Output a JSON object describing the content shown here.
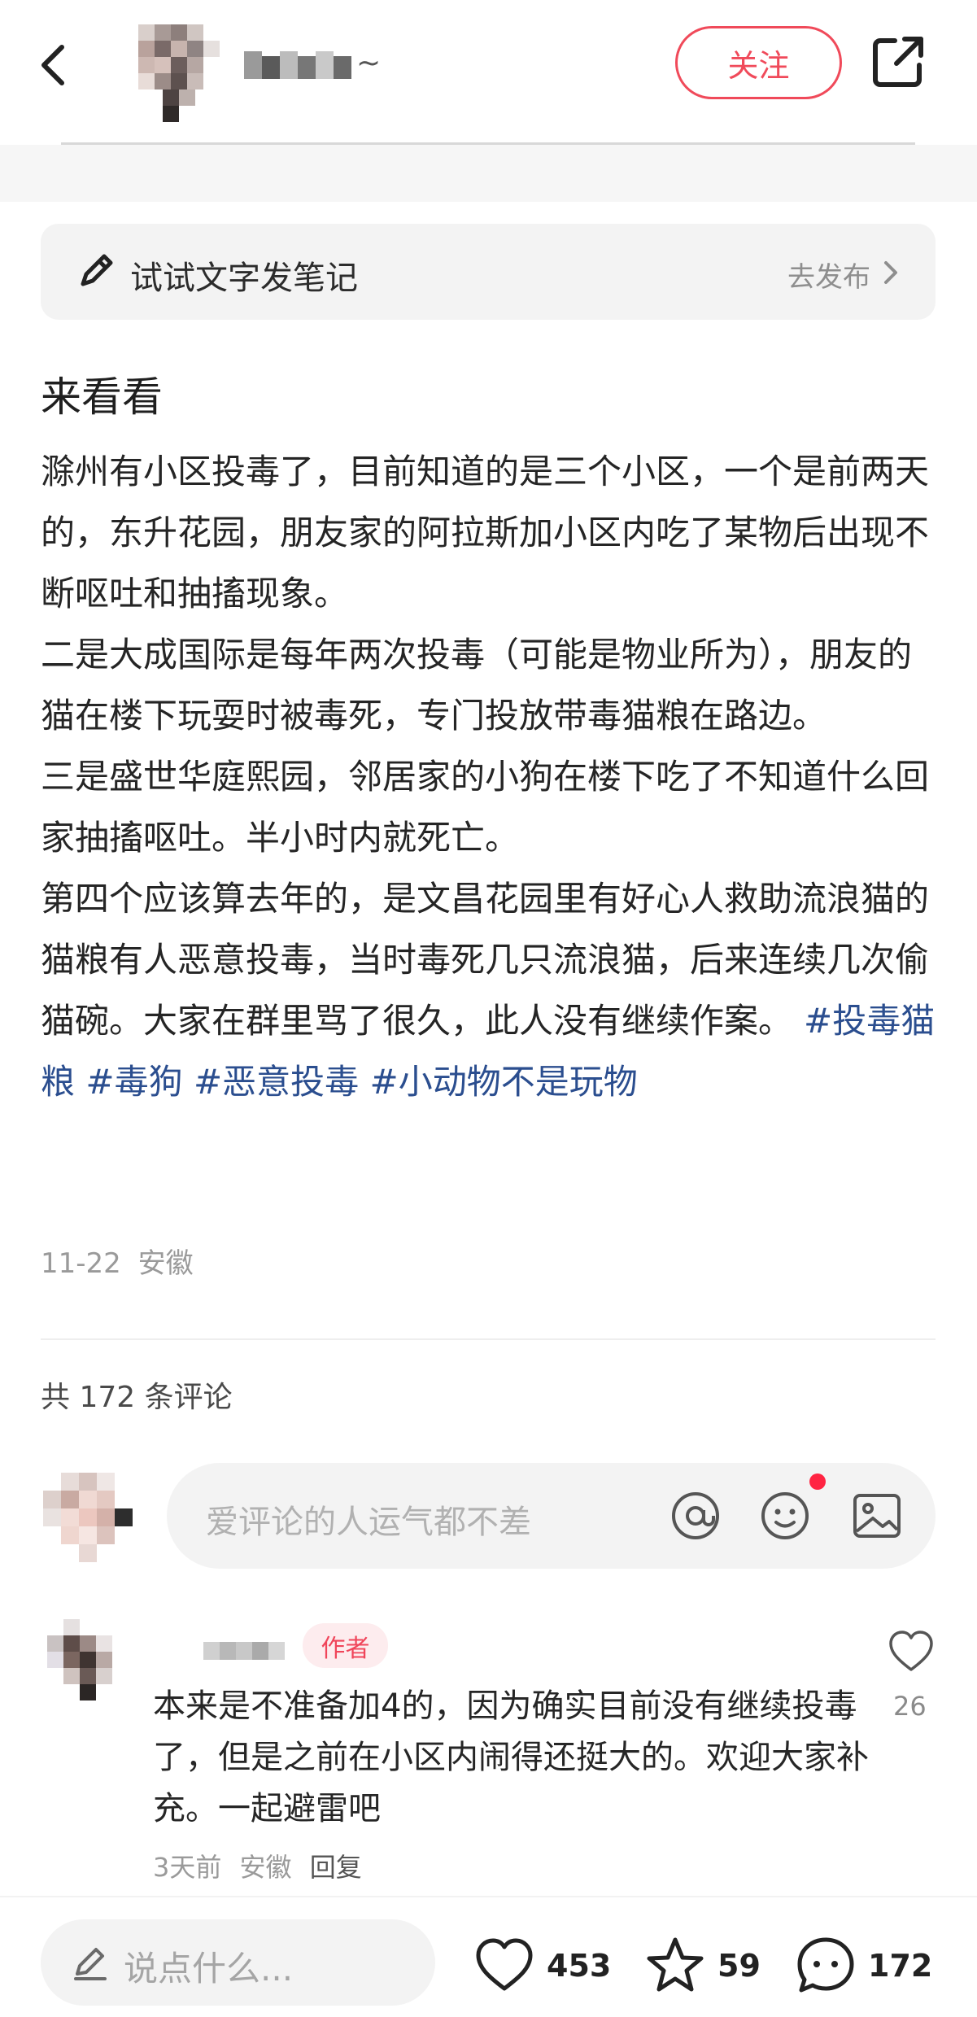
{
  "header": {
    "back_icon": "chevron-left-icon",
    "username_suffix": "~",
    "follow_label": "关注",
    "share_icon": "share-external-icon",
    "accent_color": "#f04a5a"
  },
  "note_entry": {
    "label": "试试文字发笔记",
    "action": "去发布",
    "icon": "pencil-icon"
  },
  "post": {
    "title": "来看看",
    "paragraphs": [
      "滁州有小区投毒了，目前知道的是三个小区，一个是前两天的，东升花园，朋友家的阿拉斯加小区内吃了某物后出现不断呕吐和抽搐现象。",
      "二是大成国际是每年两次投毒（可能是物业所为），朋友的猫在楼下玩耍时被毒死，专门投放带毒猫粮在路边。",
      "三是盛世华庭熙园，邻居家的小狗在楼下吃了不知道什么回家抽搐呕吐。半小时内就死亡。",
      "第四个应该算去年的，是文昌花园里有好心人救助流浪猫的猫粮有人恶意投毒，当时毒死几只流浪猫，后来连续几次偷猫碗。大家在群里骂了很久，此人没有继续作案。"
    ],
    "tags": [
      "#投毒猫粮",
      "#毒狗",
      "#恶意投毒",
      "#小动物不是玩物"
    ],
    "tag_color": "#2b4e8f",
    "date": "11-22",
    "location": "安徽"
  },
  "comments": {
    "count_label": "共 172 条评论",
    "input_placeholder": "爱评论的人运气都不差",
    "input_icons": [
      "at-icon",
      "emoji-icon",
      "image-icon"
    ],
    "items": [
      {
        "badge": "作者",
        "text": "本来是不准备加4的，因为确实目前没有继续投毒了，但是之前在小区内闹得还挺大的。欢迎大家补充。一起避雷吧",
        "time": "3天前",
        "location": "安徽",
        "reply_label": "回复",
        "likes": "26"
      }
    ]
  },
  "bottom_bar": {
    "input_placeholder": "说点什么...",
    "likes": "453",
    "stars": "59",
    "comments": "172"
  }
}
